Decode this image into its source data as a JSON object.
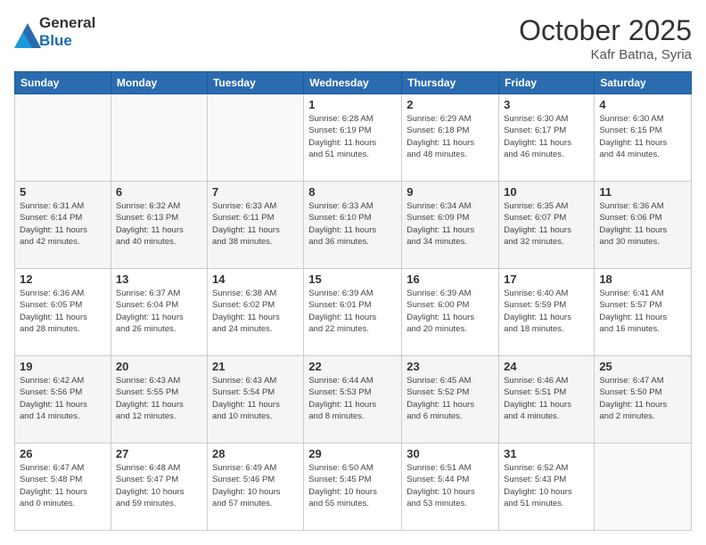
{
  "header": {
    "logo": {
      "general": "General",
      "blue": "Blue"
    },
    "title": "October 2025",
    "location": "Kafr Batna, Syria"
  },
  "days_of_week": [
    "Sunday",
    "Monday",
    "Tuesday",
    "Wednesday",
    "Thursday",
    "Friday",
    "Saturday"
  ],
  "weeks": [
    [
      {
        "day": "",
        "info": ""
      },
      {
        "day": "",
        "info": ""
      },
      {
        "day": "",
        "info": ""
      },
      {
        "day": "1",
        "info": "Sunrise: 6:28 AM\nSunset: 6:19 PM\nDaylight: 11 hours\nand 51 minutes."
      },
      {
        "day": "2",
        "info": "Sunrise: 6:29 AM\nSunset: 6:18 PM\nDaylight: 11 hours\nand 48 minutes."
      },
      {
        "day": "3",
        "info": "Sunrise: 6:30 AM\nSunset: 6:17 PM\nDaylight: 11 hours\nand 46 minutes."
      },
      {
        "day": "4",
        "info": "Sunrise: 6:30 AM\nSunset: 6:15 PM\nDaylight: 11 hours\nand 44 minutes."
      }
    ],
    [
      {
        "day": "5",
        "info": "Sunrise: 6:31 AM\nSunset: 6:14 PM\nDaylight: 11 hours\nand 42 minutes."
      },
      {
        "day": "6",
        "info": "Sunrise: 6:32 AM\nSunset: 6:13 PM\nDaylight: 11 hours\nand 40 minutes."
      },
      {
        "day": "7",
        "info": "Sunrise: 6:33 AM\nSunset: 6:11 PM\nDaylight: 11 hours\nand 38 minutes."
      },
      {
        "day": "8",
        "info": "Sunrise: 6:33 AM\nSunset: 6:10 PM\nDaylight: 11 hours\nand 36 minutes."
      },
      {
        "day": "9",
        "info": "Sunrise: 6:34 AM\nSunset: 6:09 PM\nDaylight: 11 hours\nand 34 minutes."
      },
      {
        "day": "10",
        "info": "Sunrise: 6:35 AM\nSunset: 6:07 PM\nDaylight: 11 hours\nand 32 minutes."
      },
      {
        "day": "11",
        "info": "Sunrise: 6:36 AM\nSunset: 6:06 PM\nDaylight: 11 hours\nand 30 minutes."
      }
    ],
    [
      {
        "day": "12",
        "info": "Sunrise: 6:36 AM\nSunset: 6:05 PM\nDaylight: 11 hours\nand 28 minutes."
      },
      {
        "day": "13",
        "info": "Sunrise: 6:37 AM\nSunset: 6:04 PM\nDaylight: 11 hours\nand 26 minutes."
      },
      {
        "day": "14",
        "info": "Sunrise: 6:38 AM\nSunset: 6:02 PM\nDaylight: 11 hours\nand 24 minutes."
      },
      {
        "day": "15",
        "info": "Sunrise: 6:39 AM\nSunset: 6:01 PM\nDaylight: 11 hours\nand 22 minutes."
      },
      {
        "day": "16",
        "info": "Sunrise: 6:39 AM\nSunset: 6:00 PM\nDaylight: 11 hours\nand 20 minutes."
      },
      {
        "day": "17",
        "info": "Sunrise: 6:40 AM\nSunset: 5:59 PM\nDaylight: 11 hours\nand 18 minutes."
      },
      {
        "day": "18",
        "info": "Sunrise: 6:41 AM\nSunset: 5:57 PM\nDaylight: 11 hours\nand 16 minutes."
      }
    ],
    [
      {
        "day": "19",
        "info": "Sunrise: 6:42 AM\nSunset: 5:56 PM\nDaylight: 11 hours\nand 14 minutes."
      },
      {
        "day": "20",
        "info": "Sunrise: 6:43 AM\nSunset: 5:55 PM\nDaylight: 11 hours\nand 12 minutes."
      },
      {
        "day": "21",
        "info": "Sunrise: 6:43 AM\nSunset: 5:54 PM\nDaylight: 11 hours\nand 10 minutes."
      },
      {
        "day": "22",
        "info": "Sunrise: 6:44 AM\nSunset: 5:53 PM\nDaylight: 11 hours\nand 8 minutes."
      },
      {
        "day": "23",
        "info": "Sunrise: 6:45 AM\nSunset: 5:52 PM\nDaylight: 11 hours\nand 6 minutes."
      },
      {
        "day": "24",
        "info": "Sunrise: 6:46 AM\nSunset: 5:51 PM\nDaylight: 11 hours\nand 4 minutes."
      },
      {
        "day": "25",
        "info": "Sunrise: 6:47 AM\nSunset: 5:50 PM\nDaylight: 11 hours\nand 2 minutes."
      }
    ],
    [
      {
        "day": "26",
        "info": "Sunrise: 6:47 AM\nSunset: 5:48 PM\nDaylight: 11 hours\nand 0 minutes."
      },
      {
        "day": "27",
        "info": "Sunrise: 6:48 AM\nSunset: 5:47 PM\nDaylight: 10 hours\nand 59 minutes."
      },
      {
        "day": "28",
        "info": "Sunrise: 6:49 AM\nSunset: 5:46 PM\nDaylight: 10 hours\nand 57 minutes."
      },
      {
        "day": "29",
        "info": "Sunrise: 6:50 AM\nSunset: 5:45 PM\nDaylight: 10 hours\nand 55 minutes."
      },
      {
        "day": "30",
        "info": "Sunrise: 6:51 AM\nSunset: 5:44 PM\nDaylight: 10 hours\nand 53 minutes."
      },
      {
        "day": "31",
        "info": "Sunrise: 6:52 AM\nSunset: 5:43 PM\nDaylight: 10 hours\nand 51 minutes."
      },
      {
        "day": "",
        "info": ""
      }
    ]
  ]
}
